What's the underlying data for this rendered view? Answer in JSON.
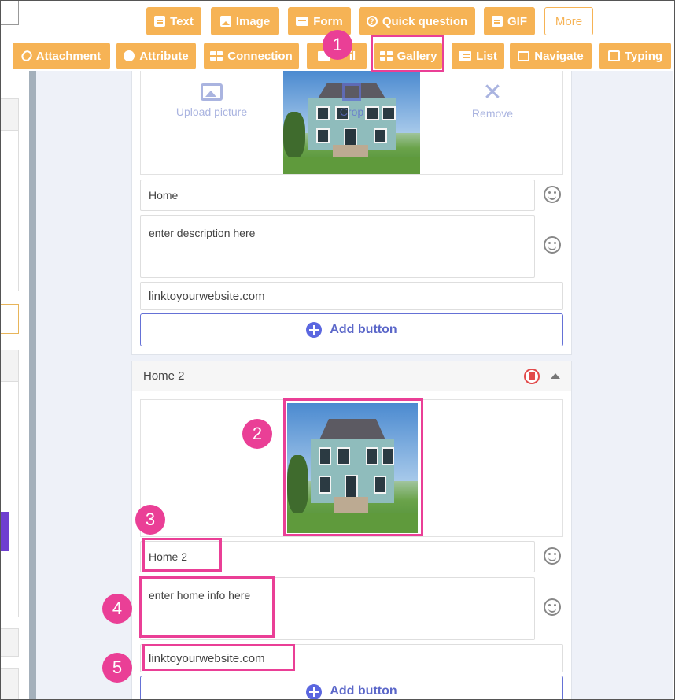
{
  "toolbar": {
    "row1": [
      {
        "label": "Text",
        "icon": "document-icon"
      },
      {
        "label": "Image",
        "icon": "image-icon"
      },
      {
        "label": "Form",
        "icon": "form-icon"
      },
      {
        "label": "Quick question",
        "icon": "question-icon"
      },
      {
        "label": "GIF",
        "icon": "gif-icon"
      },
      {
        "label": "More",
        "icon": ""
      }
    ],
    "row2": [
      {
        "label": "Attachment",
        "icon": "paperclip-icon"
      },
      {
        "label": "Attribute",
        "icon": "circle-icon"
      },
      {
        "label": "Connection",
        "icon": "table-icon"
      },
      {
        "label": "il",
        "icon": "mail-icon"
      },
      {
        "label": "Gallery",
        "icon": "gallery-icon"
      },
      {
        "label": "List",
        "icon": "list-icon"
      },
      {
        "label": "Navigate",
        "icon": "navigate-icon"
      },
      {
        "label": "Typing",
        "icon": "edit-icon"
      }
    ]
  },
  "card1": {
    "upload_label": "Upload picture",
    "crop_label": "Crop",
    "remove_label": "Remove",
    "title_value": "Home",
    "description_value": "enter description here",
    "link_value": "linktoyourwebsite.com",
    "add_button_label": "Add button"
  },
  "card2": {
    "header_title": "Home 2",
    "title_value": "Home 2",
    "description_value": "enter home info here",
    "link_value": "linktoyourwebsite.com",
    "add_button_label": "Add button"
  },
  "callouts": [
    "1",
    "2",
    "3",
    "4",
    "5"
  ],
  "colors": {
    "toolbar_orange": "#f6b355",
    "callout_pink": "#ea3f96",
    "accent_blue": "#5b67c9",
    "delete_red": "#e24a4a"
  }
}
